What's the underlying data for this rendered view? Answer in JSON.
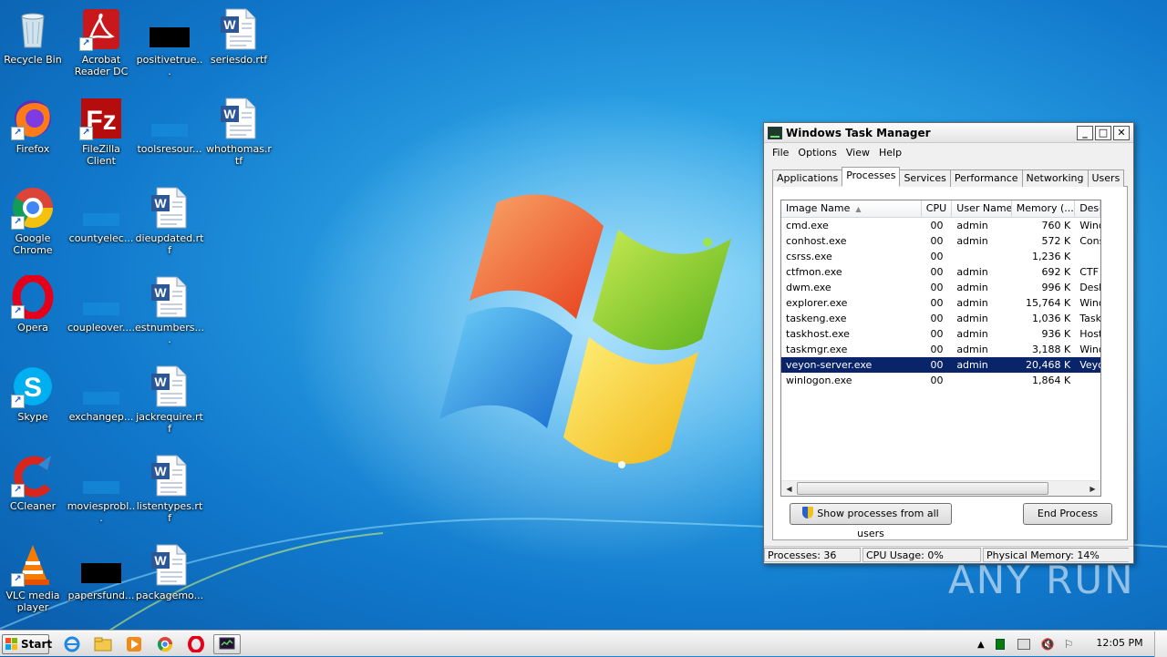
{
  "desktop": {
    "icons": [
      {
        "label": "Recycle Bin",
        "icon": "recycle-bin-icon"
      },
      {
        "label": "Acrobat Reader DC",
        "icon": "acrobat-reader-icon"
      },
      {
        "label": "positivetrue...",
        "icon": "black-file-icon"
      },
      {
        "label": "seriesdo.rtf",
        "icon": "word-document-icon"
      },
      {
        "label": "Firefox",
        "icon": "firefox-icon"
      },
      {
        "label": "FileZilla Client",
        "icon": "filezilla-icon"
      },
      {
        "label": "toolsresour...",
        "icon": "blank-file-icon"
      },
      {
        "label": "whothomas.rtf",
        "icon": "word-document-icon"
      },
      {
        "label": "Google Chrome",
        "icon": "chrome-icon"
      },
      {
        "label": "countyelec...",
        "icon": "blank-file-icon"
      },
      {
        "label": "dieupdated.rtf",
        "icon": "word-document-icon"
      },
      {
        "label": "Opera",
        "icon": "opera-icon"
      },
      {
        "label": "coupleover....",
        "icon": "blank-file-icon"
      },
      {
        "label": "estnumbers....",
        "icon": "word-document-icon"
      },
      {
        "label": "Skype",
        "icon": "skype-icon"
      },
      {
        "label": "exchangep...",
        "icon": "blank-file-icon"
      },
      {
        "label": "jackrequire.rtf",
        "icon": "word-document-icon"
      },
      {
        "label": "CCleaner",
        "icon": "ccleaner-icon"
      },
      {
        "label": "moviesprobl...",
        "icon": "blank-file-icon"
      },
      {
        "label": "listentypes.rtf",
        "icon": "word-document-icon"
      },
      {
        "label": "VLC media player",
        "icon": "vlc-icon"
      },
      {
        "label": "papersfund...",
        "icon": "black-file-icon"
      },
      {
        "label": "packagemo...",
        "icon": "word-document-icon"
      }
    ]
  },
  "task_manager": {
    "title": "Windows Task Manager",
    "window_buttons": {
      "minimize": "_",
      "maximize": "□",
      "close": "✕"
    },
    "menu": [
      "File",
      "Options",
      "View",
      "Help"
    ],
    "tabs": [
      {
        "label": "Applications",
        "active": false
      },
      {
        "label": "Processes",
        "active": true
      },
      {
        "label": "Services",
        "active": false
      },
      {
        "label": "Performance",
        "active": false
      },
      {
        "label": "Networking",
        "active": false
      },
      {
        "label": "Users",
        "active": false
      }
    ],
    "columns": [
      "Image Name",
      "CPU",
      "User Name",
      "Memory (...",
      "Desc"
    ],
    "rows": [
      {
        "name": "cmd.exe",
        "cpu": "00",
        "user": "admin",
        "memory": "760 K",
        "desc": "Wind"
      },
      {
        "name": "conhost.exe",
        "cpu": "00",
        "user": "admin",
        "memory": "572 K",
        "desc": "Cons"
      },
      {
        "name": "csrss.exe",
        "cpu": "00",
        "user": "",
        "memory": "1,236 K",
        "desc": ""
      },
      {
        "name": "ctfmon.exe",
        "cpu": "00",
        "user": "admin",
        "memory": "692 K",
        "desc": "CTF I"
      },
      {
        "name": "dwm.exe",
        "cpu": "00",
        "user": "admin",
        "memory": "996 K",
        "desc": "Desk"
      },
      {
        "name": "explorer.exe",
        "cpu": "00",
        "user": "admin",
        "memory": "15,764 K",
        "desc": "Wind"
      },
      {
        "name": "taskeng.exe",
        "cpu": "00",
        "user": "admin",
        "memory": "1,036 K",
        "desc": "Task"
      },
      {
        "name": "taskhost.exe",
        "cpu": "00",
        "user": "admin",
        "memory": "936 K",
        "desc": "Host"
      },
      {
        "name": "taskmgr.exe",
        "cpu": "00",
        "user": "admin",
        "memory": "3,188 K",
        "desc": "Wind"
      },
      {
        "name": "veyon-server.exe",
        "cpu": "00",
        "user": "admin",
        "memory": "20,468 K",
        "desc": "Veyo",
        "selected": true
      },
      {
        "name": "winlogon.exe",
        "cpu": "00",
        "user": "",
        "memory": "1,864 K",
        "desc": ""
      }
    ],
    "show_all_button": "Show processes from all users",
    "end_process_button": "End Process",
    "status": {
      "processes": "Processes: 36",
      "cpu": "CPU Usage: 0%",
      "memory": "Physical Memory: 14%"
    }
  },
  "taskbar": {
    "start_label": "Start",
    "apps": [
      "internet-explorer-icon",
      "folder-icon",
      "media-player-icon",
      "chrome-icon",
      "opera-icon",
      "task-manager-icon"
    ],
    "clock": "12:05 PM"
  },
  "watermark": "ANY RUN"
}
